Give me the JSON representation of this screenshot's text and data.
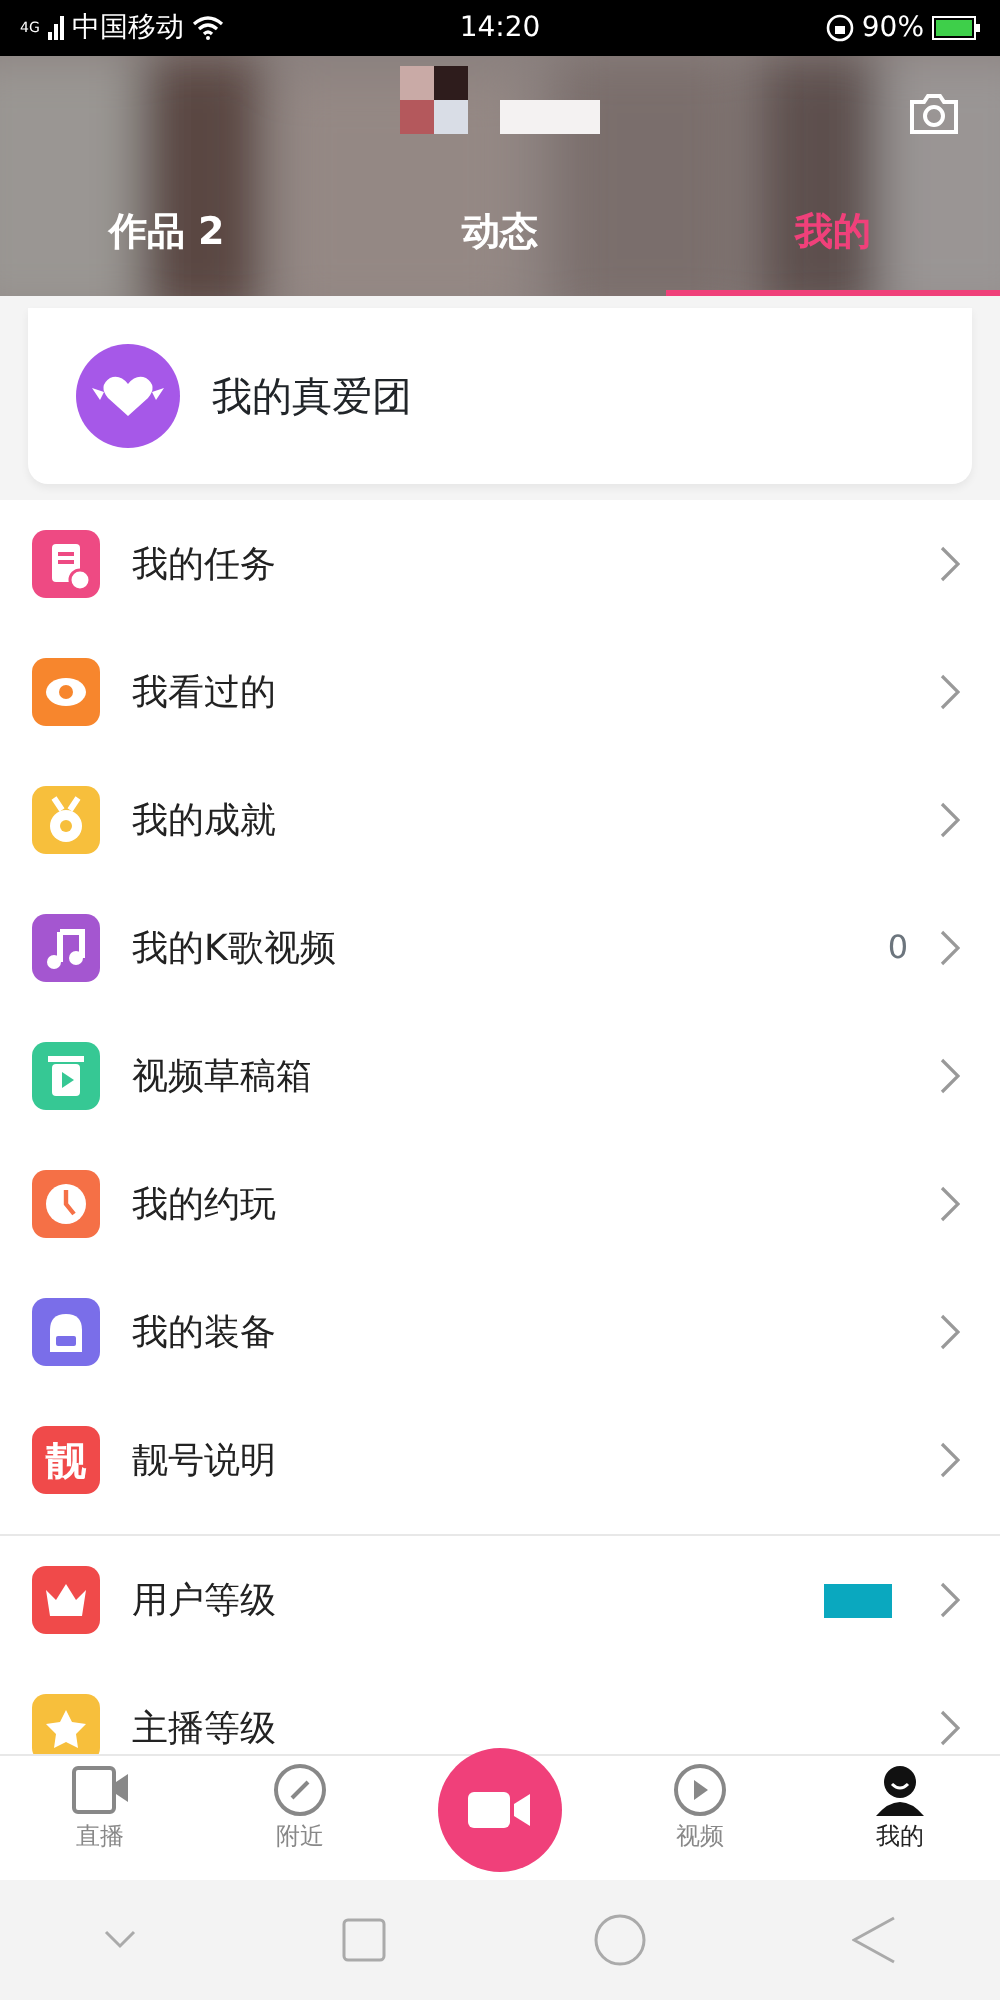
{
  "status_bar": {
    "network": "4G",
    "carrier": "中国移动",
    "time": "14:20",
    "battery": "90%"
  },
  "tabs": [
    {
      "label": "作品 2",
      "selected": false
    },
    {
      "label": "动态",
      "selected": false
    },
    {
      "label": "我的",
      "selected": true
    }
  ],
  "fan_club": {
    "label": "我的真爱团"
  },
  "menu_groups": [
    [
      {
        "label": "我的任务",
        "color": "#ee4a83"
      },
      {
        "label": "我看过的",
        "color": "#f7862d"
      },
      {
        "label": "我的成就",
        "color": "#f7bf3c"
      },
      {
        "label": "我的K歌视频",
        "color": "#a456d0",
        "value": "0"
      },
      {
        "label": "视频草稿箱",
        "color": "#36c894"
      },
      {
        "label": "我的约玩",
        "color": "#f57046"
      },
      {
        "label": "我的装备",
        "color": "#7a6ee9"
      },
      {
        "label": "靓号说明",
        "color": "#f04a4a",
        "icon_text": "靓"
      }
    ],
    [
      {
        "label": "用户等级",
        "color": "#f04a4a"
      },
      {
        "label": "主播等级",
        "color": "#f7bf3c"
      }
    ]
  ],
  "bottom_nav": [
    {
      "label": "直播",
      "selected": false
    },
    {
      "label": "附近",
      "selected": false
    },
    {
      "kind": "record"
    },
    {
      "label": "视频",
      "selected": false
    },
    {
      "label": "我的",
      "selected": true
    }
  ]
}
